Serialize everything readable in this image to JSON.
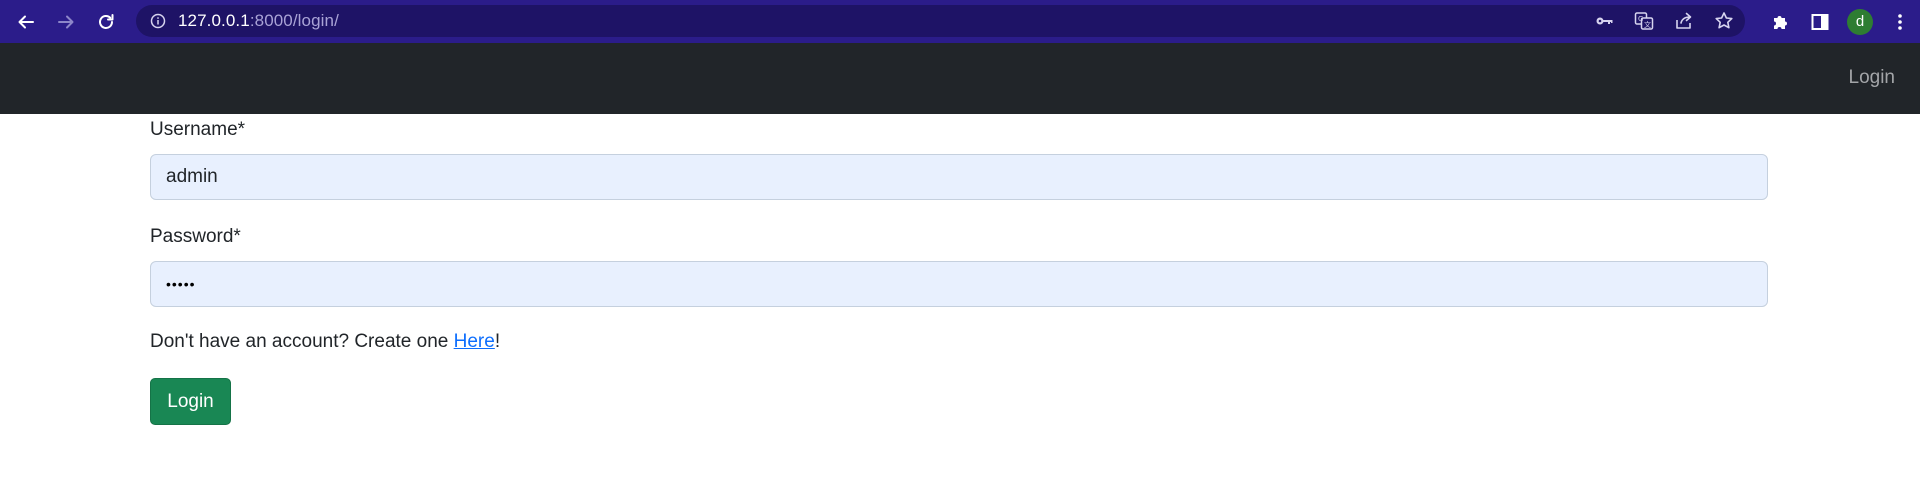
{
  "browser": {
    "url_host": "127.0.0.1",
    "url_path": ":8000/login/",
    "profile_initial": "d",
    "colors": {
      "toolbar": "#2b1c8a",
      "omnibox": "#1e1366",
      "avatar": "#2e7d32"
    },
    "icons": {
      "back": "arrow-left-icon",
      "forward": "arrow-right-icon",
      "reload": "reload-icon",
      "site_info": "info-icon",
      "password": "key-icon",
      "translate": "translate-icon",
      "share": "share-icon",
      "bookmark": "star-icon",
      "extensions": "puzzle-icon",
      "side_panel": "side-panel-icon",
      "menu": "kebab-menu-icon"
    }
  },
  "navbar": {
    "login_link": "Login",
    "background": "#212529"
  },
  "form": {
    "username_label": "Username*",
    "username_value": "admin",
    "password_label": "Password*",
    "password_value": "•••••",
    "account_prefix": "Don't have an account? Create one ",
    "account_link": "Here",
    "account_suffix": "!",
    "submit_label": "Login",
    "colors": {
      "input_autofill_bg": "#e8f0fe",
      "button": "#198754",
      "link": "#0d6efd"
    }
  }
}
